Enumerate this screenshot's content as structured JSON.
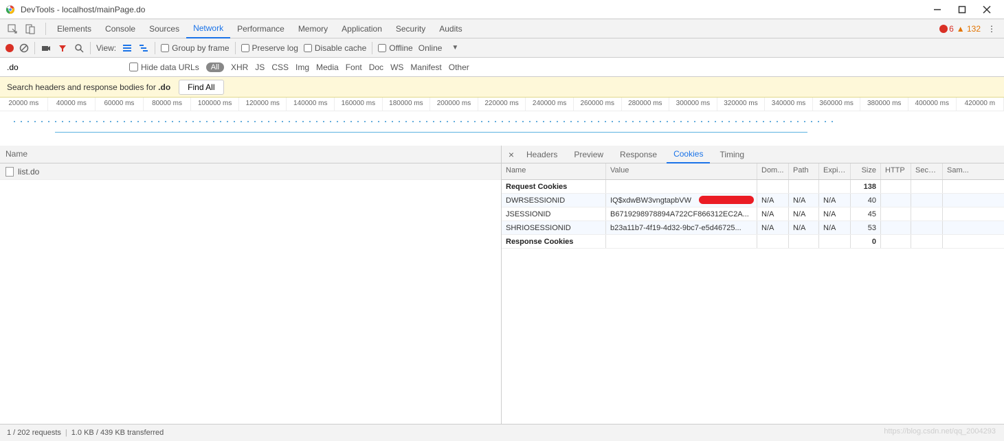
{
  "window": {
    "title": "DevTools - localhost/mainPage.do"
  },
  "tabs": [
    "Elements",
    "Console",
    "Sources",
    "Network",
    "Performance",
    "Memory",
    "Application",
    "Security",
    "Audits"
  ],
  "activeTabIndex": 3,
  "errors": {
    "count": "6"
  },
  "warnings": {
    "count": "132"
  },
  "toolbar": {
    "view": "View:",
    "groupByFrame": "Group by frame",
    "preserveLog": "Preserve log",
    "disableCache": "Disable cache",
    "offline": "Offline",
    "online": "Online"
  },
  "filter": {
    "value": ".do",
    "hideDataUrls": "Hide data URLs",
    "all": "All",
    "types": [
      "XHR",
      "JS",
      "CSS",
      "Img",
      "Media",
      "Font",
      "Doc",
      "WS",
      "Manifest",
      "Other"
    ]
  },
  "search": {
    "prefix": "Search headers and response bodies for ",
    "term": ".do",
    "findAll": "Find All"
  },
  "timeline": {
    "ticks": [
      "20000 ms",
      "40000 ms",
      "60000 ms",
      "80000 ms",
      "100000 ms",
      "120000 ms",
      "140000 ms",
      "160000 ms",
      "180000 ms",
      "200000 ms",
      "220000 ms",
      "240000 ms",
      "260000 ms",
      "280000 ms",
      "300000 ms",
      "320000 ms",
      "340000 ms",
      "360000 ms",
      "380000 ms",
      "400000 ms",
      "420000 m"
    ]
  },
  "leftPanel": {
    "header": "Name",
    "items": [
      "list.do"
    ]
  },
  "detailTabs": [
    "Headers",
    "Preview",
    "Response",
    "Cookies",
    "Timing"
  ],
  "detailActiveIndex": 3,
  "cookies": {
    "columns": [
      "Name",
      "Value",
      "Dom...",
      "Path",
      "Expir...",
      "Size",
      "HTTP",
      "Secure",
      "Sam..."
    ],
    "requestHeader": "Request Cookies",
    "requestTotal": "138",
    "responseHeader": "Response Cookies",
    "responseTotal": "0",
    "rows": [
      {
        "name": "DWRSESSIONID",
        "value": "IQ$xdwBW3vngtapbVW",
        "dom": "N/A",
        "path": "N/A",
        "exp": "N/A",
        "size": "40",
        "redacted": true
      },
      {
        "name": "JSESSIONID",
        "value": "B6719298978894A722CF866312EC2A...",
        "dom": "N/A",
        "path": "N/A",
        "exp": "N/A",
        "size": "45"
      },
      {
        "name": "SHRIOSESSIONID",
        "value": "b23a11b7-4f19-4d32-9bc7-e5d46725...",
        "dom": "N/A",
        "path": "N/A",
        "exp": "N/A",
        "size": "53"
      }
    ]
  },
  "status": {
    "requests": "1 / 202 requests",
    "transferred": "1.0 KB / 439 KB transferred"
  },
  "watermark": "https://blog.csdn.net/qq_2004293"
}
